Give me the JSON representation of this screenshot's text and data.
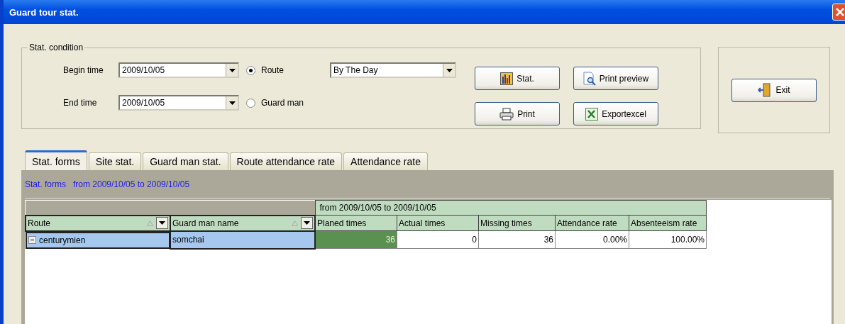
{
  "window": {
    "title": "Guard tour stat."
  },
  "condition": {
    "legend": "Stat. condition",
    "begin": {
      "label": "Begin time",
      "value": "2009/10/05"
    },
    "end": {
      "label": "End time",
      "value": "2009/10/05"
    },
    "modes": [
      {
        "label": "Route",
        "selected": true
      },
      {
        "label": "Guard man",
        "selected": false
      }
    ],
    "period": {
      "value": "By The Day"
    }
  },
  "buttons": [
    {
      "label": "Stat.",
      "kind": "chart"
    },
    {
      "label": "Print preview",
      "kind": "preview"
    },
    {
      "label": "Print",
      "kind": "print"
    },
    {
      "label": "Exportexcel",
      "kind": "excel"
    }
  ],
  "exit": {
    "label": "Exit"
  },
  "tabs": [
    {
      "label": "Stat. forms",
      "selected": true
    },
    {
      "label": "Site stat.",
      "selected": false
    },
    {
      "label": "Guard man stat.",
      "selected": false
    },
    {
      "label": "Route attendance rate",
      "selected": false
    },
    {
      "label": "Attendance rate",
      "selected": false
    }
  ],
  "caption": "Stat. forms   from 2009/10/05 to 2009/10/05",
  "table": {
    "group_columns": [
      "Route",
      "Guard man name"
    ],
    "band": "from 2009/10/05 to 2009/10/05",
    "columns": [
      "Planed times",
      "Actual times",
      "Missing times",
      "Attendance rate",
      "Absenteeism rate"
    ],
    "rows": [
      {
        "expanded": true,
        "groups": [
          "centurymien",
          "somchai"
        ],
        "cells": [
          {
            "text": "36",
            "selected": true
          },
          {
            "text": "0",
            "selected": false
          },
          {
            "text": "36",
            "selected": false
          },
          {
            "text": "0.00%",
            "selected": false
          },
          {
            "text": "100.00%",
            "selected": false
          }
        ]
      }
    ]
  }
}
